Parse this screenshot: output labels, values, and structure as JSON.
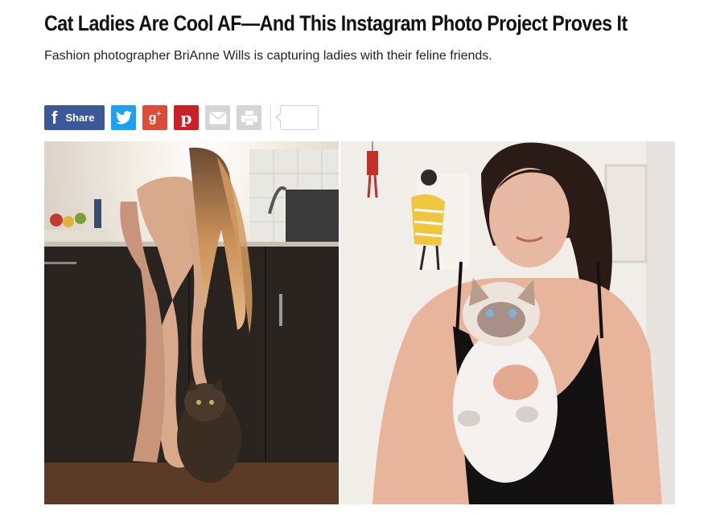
{
  "article": {
    "headline": "Cat Ladies Are Cool AF—And This Instagram Photo Project Proves It",
    "dek": "Fashion photographer BriAnne Wills is capturing ladies with their feline friends."
  },
  "share": {
    "facebook_label": "Share",
    "count": ""
  },
  "colors": {
    "facebook": "#3b5998",
    "twitter": "#1da1f2",
    "googleplus": "#dd4b39",
    "pinterest": "#cb2027",
    "neutral": "#d5d5d5"
  },
  "icons": [
    "facebook-icon",
    "twitter-icon",
    "google-plus-icon",
    "pinterest-icon",
    "email-icon",
    "print-icon"
  ]
}
